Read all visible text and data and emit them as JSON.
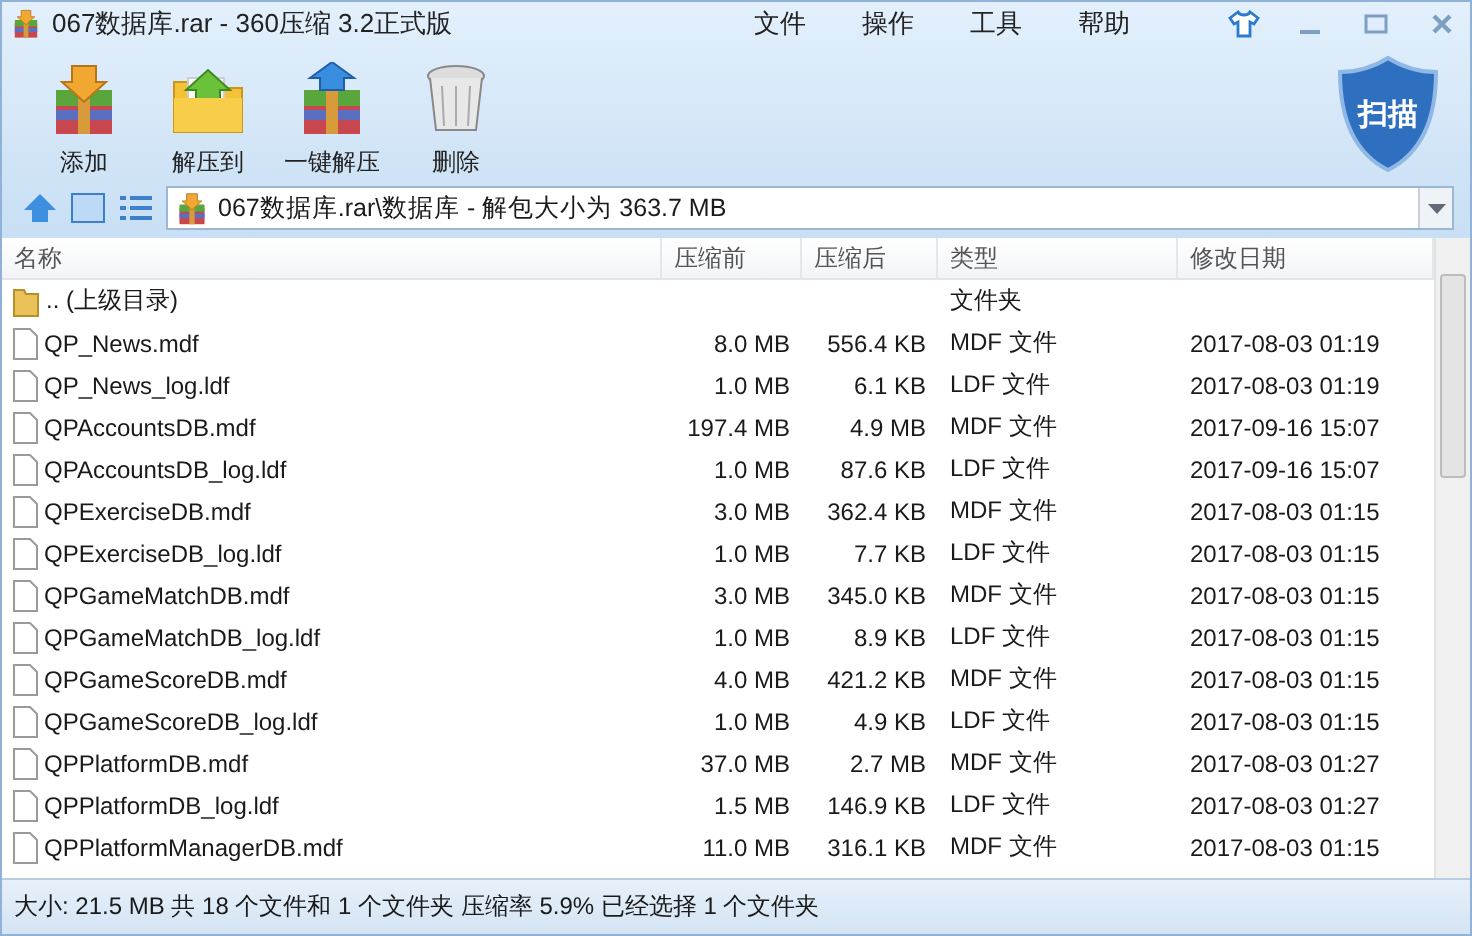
{
  "window": {
    "title": "067数据库.rar - 360压缩 3.2正式版"
  },
  "menu": [
    "文件",
    "操作",
    "工具",
    "帮助"
  ],
  "toolbar": [
    {
      "label": "添加",
      "kind": "add"
    },
    {
      "label": "解压到",
      "kind": "extract"
    },
    {
      "label": "一键解压",
      "kind": "quick"
    },
    {
      "label": "删除",
      "kind": "delete"
    }
  ],
  "scan_button": {
    "label": "扫描"
  },
  "address": {
    "path": "067数据库.rar\\数据库 - 解包大小为 363.7 MB"
  },
  "table": {
    "columns": [
      "名称",
      "压缩前",
      "压缩后",
      "类型",
      "修改日期"
    ],
    "rows": [
      {
        "kind": "folder",
        "name": ".. (上级目录)",
        "type": "文件夹"
      },
      {
        "kind": "file",
        "name": "QP_News.mdf",
        "size": "8.0 MB",
        "packed": "556.4 KB",
        "type": "MDF 文件",
        "modified": "2017-08-03 01:19"
      },
      {
        "kind": "file",
        "name": "QP_News_log.ldf",
        "size": "1.0 MB",
        "packed": "6.1 KB",
        "type": "LDF 文件",
        "modified": "2017-08-03 01:19"
      },
      {
        "kind": "file",
        "name": "QPAccountsDB.mdf",
        "size": "197.4 MB",
        "packed": "4.9 MB",
        "type": "MDF 文件",
        "modified": "2017-09-16 15:07"
      },
      {
        "kind": "file",
        "name": "QPAccountsDB_log.ldf",
        "size": "1.0 MB",
        "packed": "87.6 KB",
        "type": "LDF 文件",
        "modified": "2017-09-16 15:07"
      },
      {
        "kind": "file",
        "name": "QPExerciseDB.mdf",
        "size": "3.0 MB",
        "packed": "362.4 KB",
        "type": "MDF 文件",
        "modified": "2017-08-03 01:15"
      },
      {
        "kind": "file",
        "name": "QPExerciseDB_log.ldf",
        "size": "1.0 MB",
        "packed": "7.7 KB",
        "type": "LDF 文件",
        "modified": "2017-08-03 01:15"
      },
      {
        "kind": "file",
        "name": "QPGameMatchDB.mdf",
        "size": "3.0 MB",
        "packed": "345.0 KB",
        "type": "MDF 文件",
        "modified": "2017-08-03 01:15"
      },
      {
        "kind": "file",
        "name": "QPGameMatchDB_log.ldf",
        "size": "1.0 MB",
        "packed": "8.9 KB",
        "type": "LDF 文件",
        "modified": "2017-08-03 01:15"
      },
      {
        "kind": "file",
        "name": "QPGameScoreDB.mdf",
        "size": "4.0 MB",
        "packed": "421.2 KB",
        "type": "MDF 文件",
        "modified": "2017-08-03 01:15"
      },
      {
        "kind": "file",
        "name": "QPGameScoreDB_log.ldf",
        "size": "1.0 MB",
        "packed": "4.9 KB",
        "type": "LDF 文件",
        "modified": "2017-08-03 01:15"
      },
      {
        "kind": "file",
        "name": "QPPlatformDB.mdf",
        "size": "37.0 MB",
        "packed": "2.7 MB",
        "type": "MDF 文件",
        "modified": "2017-08-03 01:27"
      },
      {
        "kind": "file",
        "name": "QPPlatformDB_log.ldf",
        "size": "1.5 MB",
        "packed": "146.9 KB",
        "type": "LDF 文件",
        "modified": "2017-08-03 01:27"
      },
      {
        "kind": "file",
        "name": "QPPlatformManagerDB.mdf",
        "size": "11.0 MB",
        "packed": "316.1 KB",
        "type": "MDF 文件",
        "modified": "2017-08-03 01:15"
      }
    ]
  },
  "status_bar": "大小: 21.5 MB 共 18 个文件和 1 个文件夹 压缩率 5.9% 已经选择 1 个文件夹"
}
